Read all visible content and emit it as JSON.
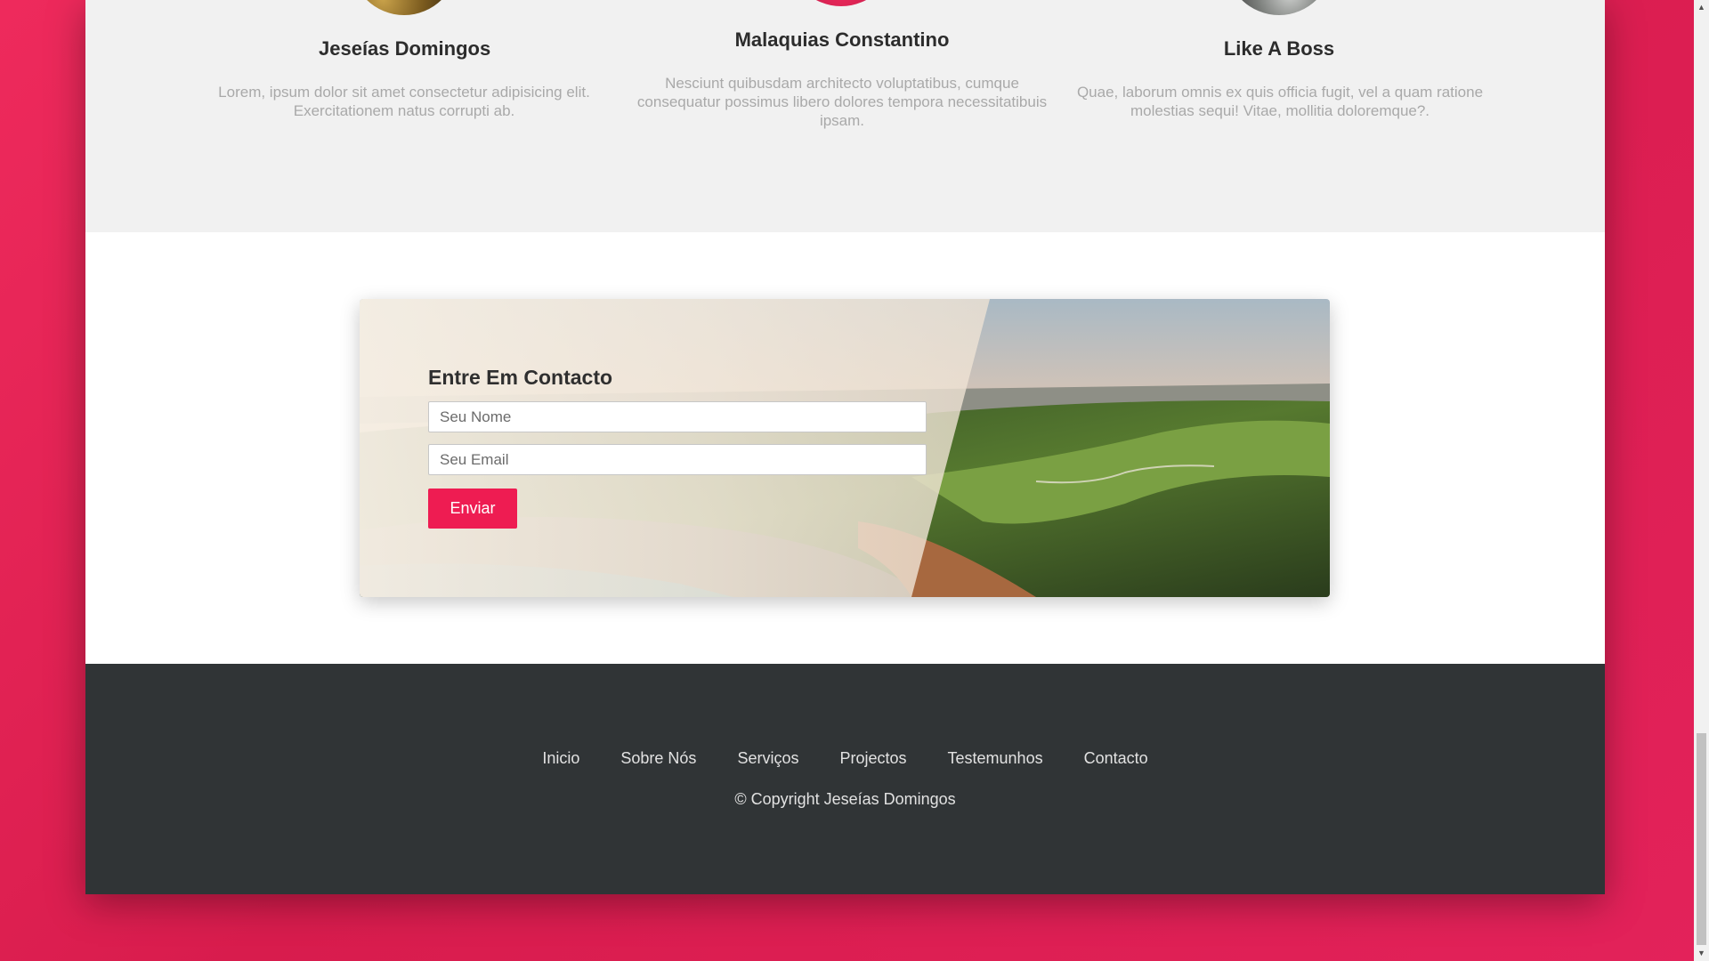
{
  "team": {
    "members": [
      {
        "name": "Jeseías Domingos",
        "bio": "Lorem, ipsum dolor sit amet consectetur adipisicing elit. Exercitationem natus corrupti ab."
      },
      {
        "name": "Malaquias Constantino",
        "bio": "Nesciunt quibusdam architecto voluptatibus, cumque consequatur possimus libero dolores tempora necessitatibuis ipsam."
      },
      {
        "name": "Like A Boss",
        "bio": "Quae, laborum omnis ex quis officia fugit, vel a quam ratione molestias sequi! Vitae, mollitia doloremque?."
      }
    ]
  },
  "contact": {
    "title": "Entre Em Contacto",
    "name_placeholder": "Seu Nome",
    "email_placeholder": "Seu Email",
    "submit_label": "Enviar"
  },
  "footer": {
    "nav": [
      "Inicio",
      "Sobre Nós",
      "Serviços",
      "Projectos",
      "Testemunhos",
      "Contacto"
    ],
    "copyright": "© Copyright Jeseías Domingos"
  },
  "colors": {
    "accent": "#ee1c52",
    "background": "#e2235a",
    "footer": "#303436"
  },
  "scrollbar": {
    "up_icon": "▲",
    "down_icon": "▼"
  }
}
